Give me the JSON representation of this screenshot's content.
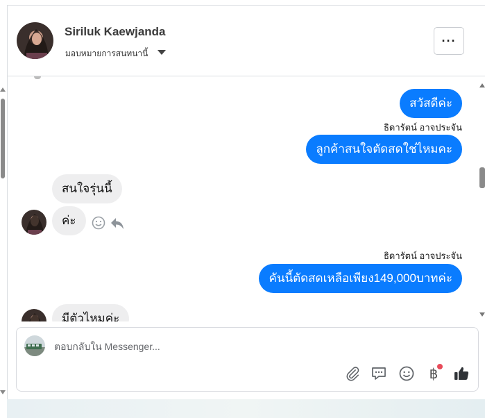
{
  "header": {
    "contact_name": "Siriluk Kaewjanda",
    "assign_label": "มอบหมายการสนทนานี้",
    "more_label": "···"
  },
  "messages": {
    "out_1": "สวัสดีค่ะ",
    "sender_1": "ธิดารัตน์ อาจประจัน",
    "out_2": "ลูกค้าสนใจตัดสดใช่ไหมคะ",
    "in_1": "สนใจรุ่นนี้",
    "in_2": "ค่ะ",
    "sender_2": "ธิดารัตน์ อาจประจัน",
    "out_3": "คันนี้ตัดสดเหลือเพียง149,000บาทค่ะ",
    "in_3_partial": "มีตัวไหมค่ะ"
  },
  "composer": {
    "placeholder": "ตอบกลับใน Messenger...",
    "baht_symbol": "฿"
  },
  "icons": {
    "attach": "paperclip-icon",
    "saved_replies": "chat-bubble-icon",
    "emoji": "smiley-icon",
    "payment": "baht-icon",
    "like": "thumbs-up-icon"
  },
  "colors": {
    "outgoing_bubble": "#0a7cff",
    "incoming_bubble": "#eeeeef",
    "notification_dot": "#e84b5a"
  }
}
